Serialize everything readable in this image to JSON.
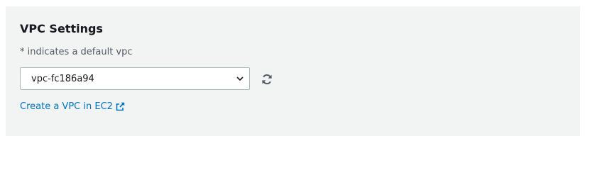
{
  "vpc_settings": {
    "title": "VPC Settings",
    "hint": "* indicates a default vpc",
    "vpc_select": {
      "selected": "vpc-fc186a94"
    },
    "refresh_icon": "refresh-icon",
    "create_link": {
      "label": "Create a VPC in EC2",
      "icon": "external-link-icon"
    }
  },
  "colors": {
    "panel_bg": "#f2f3f3",
    "link": "#0073bb",
    "text": "#16191f",
    "muted": "#545b64",
    "border": "#aab7b8"
  }
}
